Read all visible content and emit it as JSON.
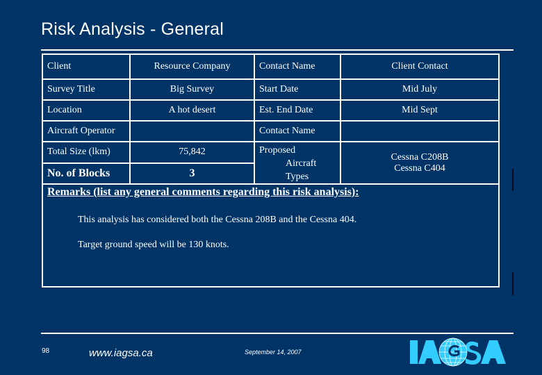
{
  "slide": {
    "title": "Risk Analysis - General"
  },
  "table": {
    "rows": [
      [
        "Client",
        "Resource Company",
        "Contact Name",
        "Client Contact"
      ],
      [
        "Survey Title",
        "Big Survey",
        "Start Date",
        "Mid July"
      ],
      [
        "Location",
        "A hot desert",
        "Est. End Date",
        "Mid Sept"
      ],
      [
        "Aircraft Operator",
        "",
        "Contact Name",
        ""
      ],
      [
        "Total Size (lkm)",
        "75,842"
      ],
      [
        "No. of Blocks",
        "3"
      ]
    ],
    "proposed_aircraft_label": [
      "Proposed",
      "Aircraft",
      "Types"
    ],
    "proposed_aircraft_values": [
      "Cessna C208B",
      "Cessna C404"
    ],
    "remarks_heading": "Remarks (list any general comments regarding this risk analysis):",
    "remarks": [
      "This analysis has considered both the Cessna 208B and the Cessna 404.",
      "Target ground speed will be 130 knots."
    ]
  },
  "footer": {
    "page_number": "98",
    "url": "www.iagsa.ca",
    "date": "September 14, 2007",
    "logo_text": "IAGSA"
  },
  "colors": {
    "background": "#003366",
    "text": "#ffffff",
    "logo": "#33ccff"
  }
}
